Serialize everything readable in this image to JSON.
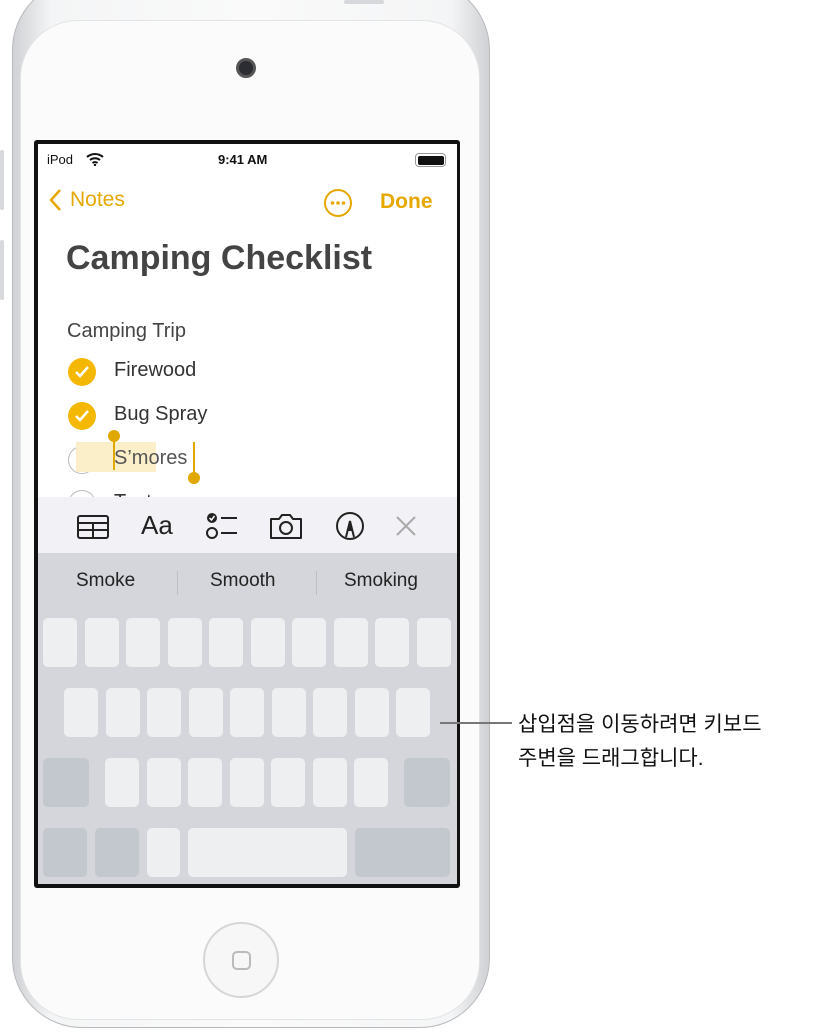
{
  "status_bar": {
    "carrier": "iPod",
    "time": "9:41 AM"
  },
  "nav": {
    "back_label": "Notes",
    "more_icon": "ellipsis-circle-icon",
    "done_label": "Done"
  },
  "note": {
    "title": "Camping Checklist",
    "subtitle": "Camping Trip",
    "items": [
      {
        "label": "Firewood",
        "checked": true
      },
      {
        "label": "Bug Spray",
        "checked": true
      },
      {
        "label": "S’mores",
        "checked": false,
        "selected": true
      },
      {
        "label": "Tent",
        "checked": false
      }
    ]
  },
  "toolbar": {
    "icons": [
      "table-icon",
      "text-format-icon",
      "checklist-icon",
      "camera-icon",
      "markup-pen-icon",
      "close-icon"
    ],
    "format_label": "Aa"
  },
  "suggestions": [
    "Smoke",
    "Smooth",
    "Smoking"
  ],
  "callout": {
    "line1": "삽입점을 이동하려면 키보드",
    "line2": "주변을 드래그합니다."
  },
  "colors": {
    "accent": "#e6a800",
    "keyboard": "#d4d6db",
    "key": "#eeeff1"
  }
}
